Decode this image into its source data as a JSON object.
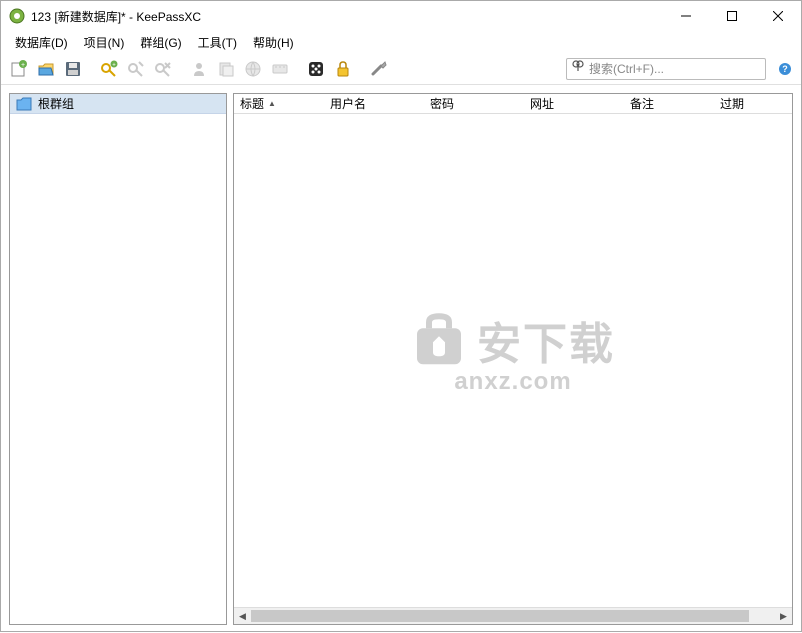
{
  "titlebar": {
    "title": "123 [新建数据库]* - KeePassXC"
  },
  "menubar": {
    "items": [
      {
        "label": "数据库(D)"
      },
      {
        "label": "项目(N)"
      },
      {
        "label": "群组(G)"
      },
      {
        "label": "工具(T)"
      },
      {
        "label": "帮助(H)"
      }
    ]
  },
  "search": {
    "placeholder": "搜索(Ctrl+F)..."
  },
  "sidebar": {
    "root_label": "根群组"
  },
  "columns": {
    "title": "标题",
    "username": "用户名",
    "password": "密码",
    "url": "网址",
    "notes": "备注",
    "expires": "过期"
  },
  "watermark": {
    "main": "安下载",
    "sub": "anxz.com"
  }
}
